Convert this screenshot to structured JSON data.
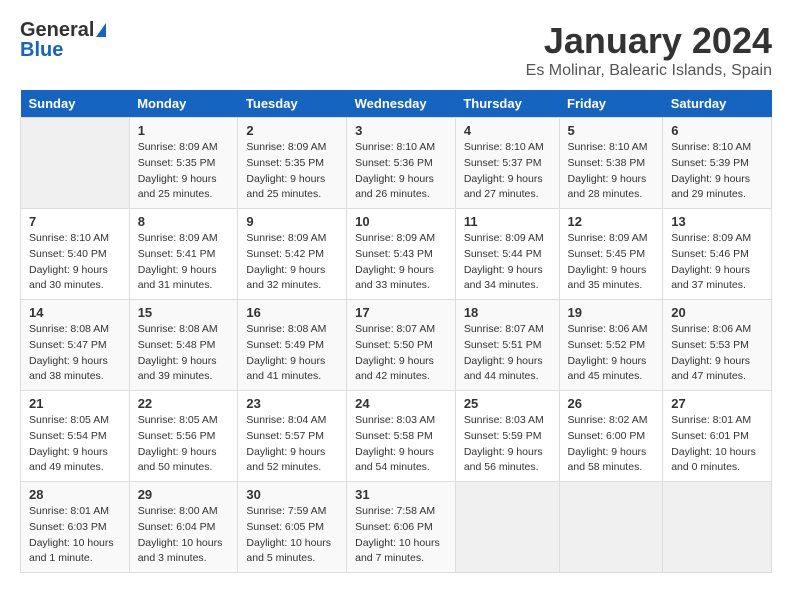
{
  "header": {
    "logo_general": "General",
    "logo_blue": "Blue",
    "main_title": "January 2024",
    "subtitle": "Es Molinar, Balearic Islands, Spain"
  },
  "calendar": {
    "days_of_week": [
      "Sunday",
      "Monday",
      "Tuesday",
      "Wednesday",
      "Thursday",
      "Friday",
      "Saturday"
    ],
    "weeks": [
      [
        {
          "day": "",
          "info": ""
        },
        {
          "day": "1",
          "info": "Sunrise: 8:09 AM\nSunset: 5:35 PM\nDaylight: 9 hours\nand 25 minutes."
        },
        {
          "day": "2",
          "info": "Sunrise: 8:09 AM\nSunset: 5:35 PM\nDaylight: 9 hours\nand 25 minutes."
        },
        {
          "day": "3",
          "info": "Sunrise: 8:10 AM\nSunset: 5:36 PM\nDaylight: 9 hours\nand 26 minutes."
        },
        {
          "day": "4",
          "info": "Sunrise: 8:10 AM\nSunset: 5:37 PM\nDaylight: 9 hours\nand 27 minutes."
        },
        {
          "day": "5",
          "info": "Sunrise: 8:10 AM\nSunset: 5:38 PM\nDaylight: 9 hours\nand 28 minutes."
        },
        {
          "day": "6",
          "info": "Sunrise: 8:10 AM\nSunset: 5:39 PM\nDaylight: 9 hours\nand 29 minutes."
        }
      ],
      [
        {
          "day": "7",
          "info": "Sunrise: 8:10 AM\nSunset: 5:40 PM\nDaylight: 9 hours\nand 30 minutes."
        },
        {
          "day": "8",
          "info": "Sunrise: 8:09 AM\nSunset: 5:41 PM\nDaylight: 9 hours\nand 31 minutes."
        },
        {
          "day": "9",
          "info": "Sunrise: 8:09 AM\nSunset: 5:42 PM\nDaylight: 9 hours\nand 32 minutes."
        },
        {
          "day": "10",
          "info": "Sunrise: 8:09 AM\nSunset: 5:43 PM\nDaylight: 9 hours\nand 33 minutes."
        },
        {
          "day": "11",
          "info": "Sunrise: 8:09 AM\nSunset: 5:44 PM\nDaylight: 9 hours\nand 34 minutes."
        },
        {
          "day": "12",
          "info": "Sunrise: 8:09 AM\nSunset: 5:45 PM\nDaylight: 9 hours\nand 35 minutes."
        },
        {
          "day": "13",
          "info": "Sunrise: 8:09 AM\nSunset: 5:46 PM\nDaylight: 9 hours\nand 37 minutes."
        }
      ],
      [
        {
          "day": "14",
          "info": "Sunrise: 8:08 AM\nSunset: 5:47 PM\nDaylight: 9 hours\nand 38 minutes."
        },
        {
          "day": "15",
          "info": "Sunrise: 8:08 AM\nSunset: 5:48 PM\nDaylight: 9 hours\nand 39 minutes."
        },
        {
          "day": "16",
          "info": "Sunrise: 8:08 AM\nSunset: 5:49 PM\nDaylight: 9 hours\nand 41 minutes."
        },
        {
          "day": "17",
          "info": "Sunrise: 8:07 AM\nSunset: 5:50 PM\nDaylight: 9 hours\nand 42 minutes."
        },
        {
          "day": "18",
          "info": "Sunrise: 8:07 AM\nSunset: 5:51 PM\nDaylight: 9 hours\nand 44 minutes."
        },
        {
          "day": "19",
          "info": "Sunrise: 8:06 AM\nSunset: 5:52 PM\nDaylight: 9 hours\nand 45 minutes."
        },
        {
          "day": "20",
          "info": "Sunrise: 8:06 AM\nSunset: 5:53 PM\nDaylight: 9 hours\nand 47 minutes."
        }
      ],
      [
        {
          "day": "21",
          "info": "Sunrise: 8:05 AM\nSunset: 5:54 PM\nDaylight: 9 hours\nand 49 minutes."
        },
        {
          "day": "22",
          "info": "Sunrise: 8:05 AM\nSunset: 5:56 PM\nDaylight: 9 hours\nand 50 minutes."
        },
        {
          "day": "23",
          "info": "Sunrise: 8:04 AM\nSunset: 5:57 PM\nDaylight: 9 hours\nand 52 minutes."
        },
        {
          "day": "24",
          "info": "Sunrise: 8:03 AM\nSunset: 5:58 PM\nDaylight: 9 hours\nand 54 minutes."
        },
        {
          "day": "25",
          "info": "Sunrise: 8:03 AM\nSunset: 5:59 PM\nDaylight: 9 hours\nand 56 minutes."
        },
        {
          "day": "26",
          "info": "Sunrise: 8:02 AM\nSunset: 6:00 PM\nDaylight: 9 hours\nand 58 minutes."
        },
        {
          "day": "27",
          "info": "Sunrise: 8:01 AM\nSunset: 6:01 PM\nDaylight: 10 hours\nand 0 minutes."
        }
      ],
      [
        {
          "day": "28",
          "info": "Sunrise: 8:01 AM\nSunset: 6:03 PM\nDaylight: 10 hours\nand 1 minute."
        },
        {
          "day": "29",
          "info": "Sunrise: 8:00 AM\nSunset: 6:04 PM\nDaylight: 10 hours\nand 3 minutes."
        },
        {
          "day": "30",
          "info": "Sunrise: 7:59 AM\nSunset: 6:05 PM\nDaylight: 10 hours\nand 5 minutes."
        },
        {
          "day": "31",
          "info": "Sunrise: 7:58 AM\nSunset: 6:06 PM\nDaylight: 10 hours\nand 7 minutes."
        },
        {
          "day": "",
          "info": ""
        },
        {
          "day": "",
          "info": ""
        },
        {
          "day": "",
          "info": ""
        }
      ]
    ]
  }
}
